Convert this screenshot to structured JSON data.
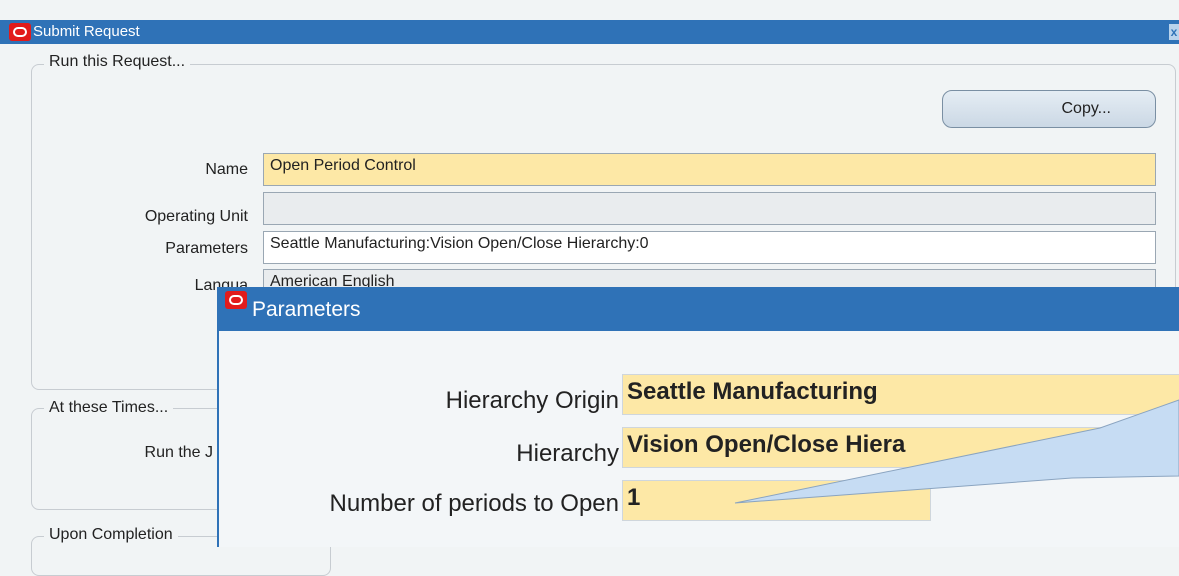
{
  "window": {
    "title": "Submit Request",
    "close_glyph": "x"
  },
  "run_group": {
    "legend": "Run this Request...",
    "copy_button": "Copy...",
    "fields": {
      "name_label": "Name",
      "name_value": "Open Period Control",
      "operating_unit_label": "Operating Unit",
      "operating_unit_value": "",
      "parameters_label": "Parameters",
      "parameters_value": "Seattle Manufacturing:Vision Open/Close Hierarchy:0",
      "language_label": "Langua",
      "language_value": "American English"
    }
  },
  "times_group": {
    "legend": "At these Times...",
    "run_label": "Run the J"
  },
  "completion_group": {
    "legend": "Upon Completion"
  },
  "parameters_dialog": {
    "title": "Parameters",
    "hierarchy_origin_label": "Hierarchy Origin",
    "hierarchy_origin_value": "Seattle Manufacturing",
    "hierarchy_label": "Hierarchy",
    "hierarchy_value": "Vision Open/Close Hiera",
    "periods_label": "Number of periods to Open",
    "periods_value": "1"
  },
  "colors": {
    "title_bar": "#2f72b7",
    "required_field": "#fde8a6",
    "callout": "#c6dcf3"
  }
}
